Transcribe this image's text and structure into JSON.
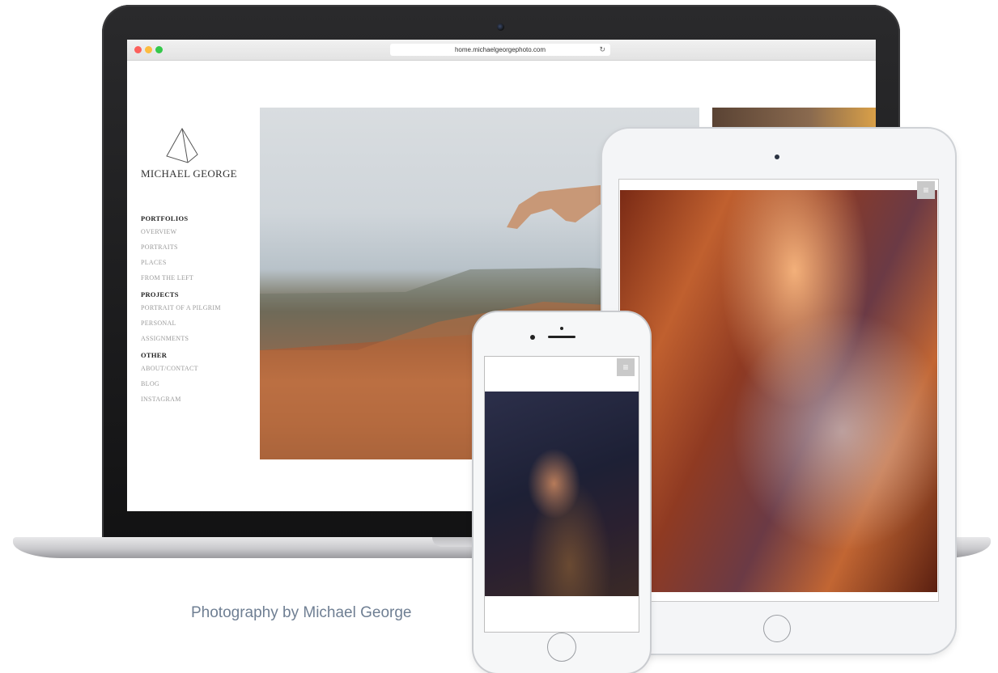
{
  "browser": {
    "url": "home.michaelgeorgephoto.com",
    "reload_icon": "reload-icon"
  },
  "site": {
    "brand": "MICHAEL GEORGE",
    "logo_icon": "pyramid-logo-icon",
    "nav": [
      {
        "heading": "PORTFOLIOS",
        "items": [
          "OVERVIEW",
          "PORTRAITS",
          "PLACES",
          "FROM THE LEFT"
        ]
      },
      {
        "heading": "PROJECTS",
        "items": [
          "PORTRAIT OF A PILGRIM",
          "PERSONAL",
          "ASSIGNMENTS"
        ]
      },
      {
        "heading": "OTHER",
        "items": [
          "ABOUT/CONTACT",
          "BLOG",
          "INSTAGRAM"
        ]
      }
    ]
  },
  "devices": {
    "menu_icon": "hamburger-menu-icon"
  },
  "caption": "Photography by Michael George",
  "colors": {
    "traffic_red": "#fc605c",
    "traffic_yellow": "#fdbc40",
    "traffic_green": "#34c84a",
    "caption": "#6f7f93"
  }
}
